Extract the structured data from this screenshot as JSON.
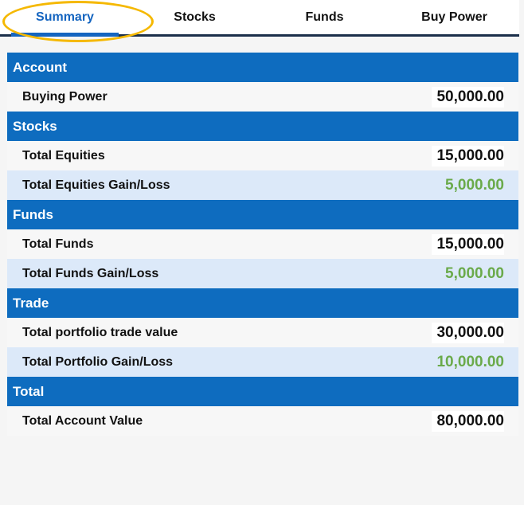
{
  "tabs": [
    {
      "label": "Summary",
      "active": true
    },
    {
      "label": "Stocks",
      "active": false
    },
    {
      "label": "Funds",
      "active": false
    },
    {
      "label": "Buy Power",
      "active": false
    }
  ],
  "sections": {
    "account": {
      "title": "Account",
      "rows": [
        {
          "label": "Buying Power",
          "value": "50,000.00"
        }
      ]
    },
    "stocks": {
      "title": "Stocks",
      "rows": [
        {
          "label": "Total Equities",
          "value": "15,000.00"
        },
        {
          "label": "Total Equities Gain/Loss",
          "value": "5,000.00"
        }
      ]
    },
    "funds": {
      "title": "Funds",
      "rows": [
        {
          "label": "Total Funds",
          "value": "15,000.00"
        },
        {
          "label": "Total Funds Gain/Loss",
          "value": "5,000.00"
        }
      ]
    },
    "trade": {
      "title": "Trade",
      "rows": [
        {
          "label": "Total portfolio trade value",
          "value": "30,000.00"
        },
        {
          "label": "Total Portfolio Gain/Loss",
          "value": "10,000.00"
        }
      ]
    },
    "total": {
      "title": "Total",
      "rows": [
        {
          "label": "Total Account Value",
          "value": "80,000.00"
        }
      ]
    }
  },
  "colors": {
    "header_blue": "#0e6cbf",
    "active_tab": "#1565c0",
    "gain_green": "#6aaa4a",
    "highlight": "#f5b800"
  }
}
